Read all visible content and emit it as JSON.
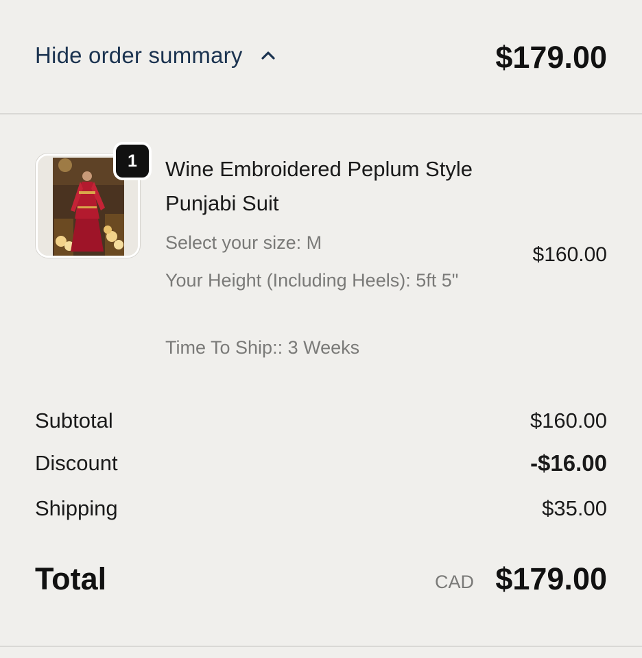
{
  "header": {
    "toggle_label": "Hide order summary",
    "toggle_icon": "chevron-up-icon",
    "total": "$179.00"
  },
  "item": {
    "quantity": "1",
    "title": "Wine Embroidered Peplum Style Punjabi Suit",
    "options": {
      "size": "Select your size: M",
      "height": "Your Height (Including Heels): 5ft 5\"",
      "ship": "Time To Ship:: 3 Weeks"
    },
    "price": "$160.00"
  },
  "totals": {
    "subtotal_label": "Subtotal",
    "subtotal_value": "$160.00",
    "discount_label": "Discount",
    "discount_value": "-$16.00",
    "shipping_label": "Shipping",
    "shipping_value": "$35.00",
    "total_label": "Total",
    "currency": "CAD",
    "total_value": "$179.00"
  },
  "colors": {
    "background": "#f0efec",
    "link_text": "#1b3350",
    "muted_text": "#7a7a78",
    "badge": "#111111"
  }
}
